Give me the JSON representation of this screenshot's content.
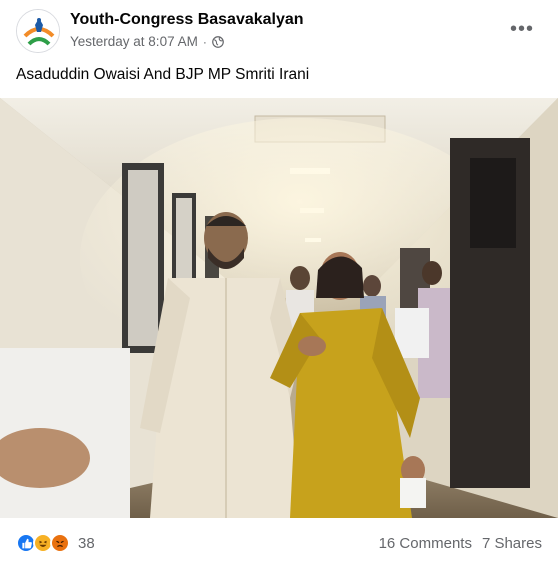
{
  "post": {
    "page_name": "Youth-Congress Basavakalyan",
    "timestamp": "Yesterday at 8:07 AM",
    "separator": "·",
    "privacy_icon": "globe-icon",
    "more_icon": "more-options-icon",
    "more_label": "•••",
    "caption": "Asaduddin Owaisi And BJP MP Smriti Irani"
  },
  "reactions": {
    "icons": [
      "like-icon",
      "haha-icon",
      "angry-icon"
    ],
    "count": "38"
  },
  "stats": {
    "comments": "16 Comments",
    "shares": "7 Shares"
  },
  "colors": {
    "name_text": "#050505",
    "meta_text": "#65676b",
    "like_blue": "#1877f2",
    "haha_yellow": "#f7b125",
    "angry_orange": "#e9710f"
  }
}
